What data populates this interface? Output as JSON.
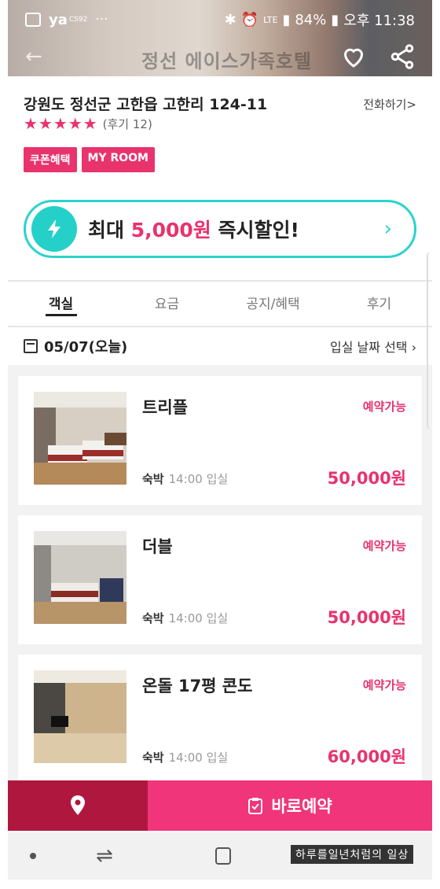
{
  "status_bar": {
    "app1": "ya",
    "app1_sub": "CS92",
    "battery": "84%",
    "time": "오후 11:38",
    "network": "LTE"
  },
  "header": {
    "title": "정선 에이스가족호텔",
    "back_icon": "arrow-left-icon",
    "like_icon": "heart-icon",
    "share_icon": "share-icon"
  },
  "hotel": {
    "address": "강원도 정선군 고한읍 고한리 124-11",
    "call_label": "전화하기>",
    "stars": "★★★★★",
    "review_label": "(후기 12)",
    "badges": [
      "쿠폰혜택",
      "MY ROOM"
    ]
  },
  "promo": {
    "prefix": "최대 ",
    "amount": "5,000원",
    "suffix": " 즉시할인!"
  },
  "tabs": [
    "객실",
    "요금",
    "공지/혜택",
    "후기"
  ],
  "active_tab": "객실",
  "date": {
    "label": "05/07(오늘)",
    "select_label": "입실 날짜 선택"
  },
  "rooms": [
    {
      "name": "트리플",
      "status": "예약가능",
      "stay_type": "숙박",
      "checkin": "14:00 입실",
      "price": "50,000원"
    },
    {
      "name": "더블",
      "status": "예약가능",
      "stay_type": "숙박",
      "checkin": "14:00 입실",
      "price": "50,000원"
    },
    {
      "name": "온돌 17평 콘도",
      "status": "예약가능",
      "stay_type": "숙박",
      "checkin": "14:00 입실",
      "price": "60,000원"
    }
  ],
  "bottom": {
    "book_label": "바로예약"
  },
  "watermark": "하루를일년처럼의 일상",
  "colors": {
    "accent": "#e8336d",
    "teal": "#2bd3cc",
    "map_button": "#b0173e",
    "book_button": "#f0357a"
  }
}
